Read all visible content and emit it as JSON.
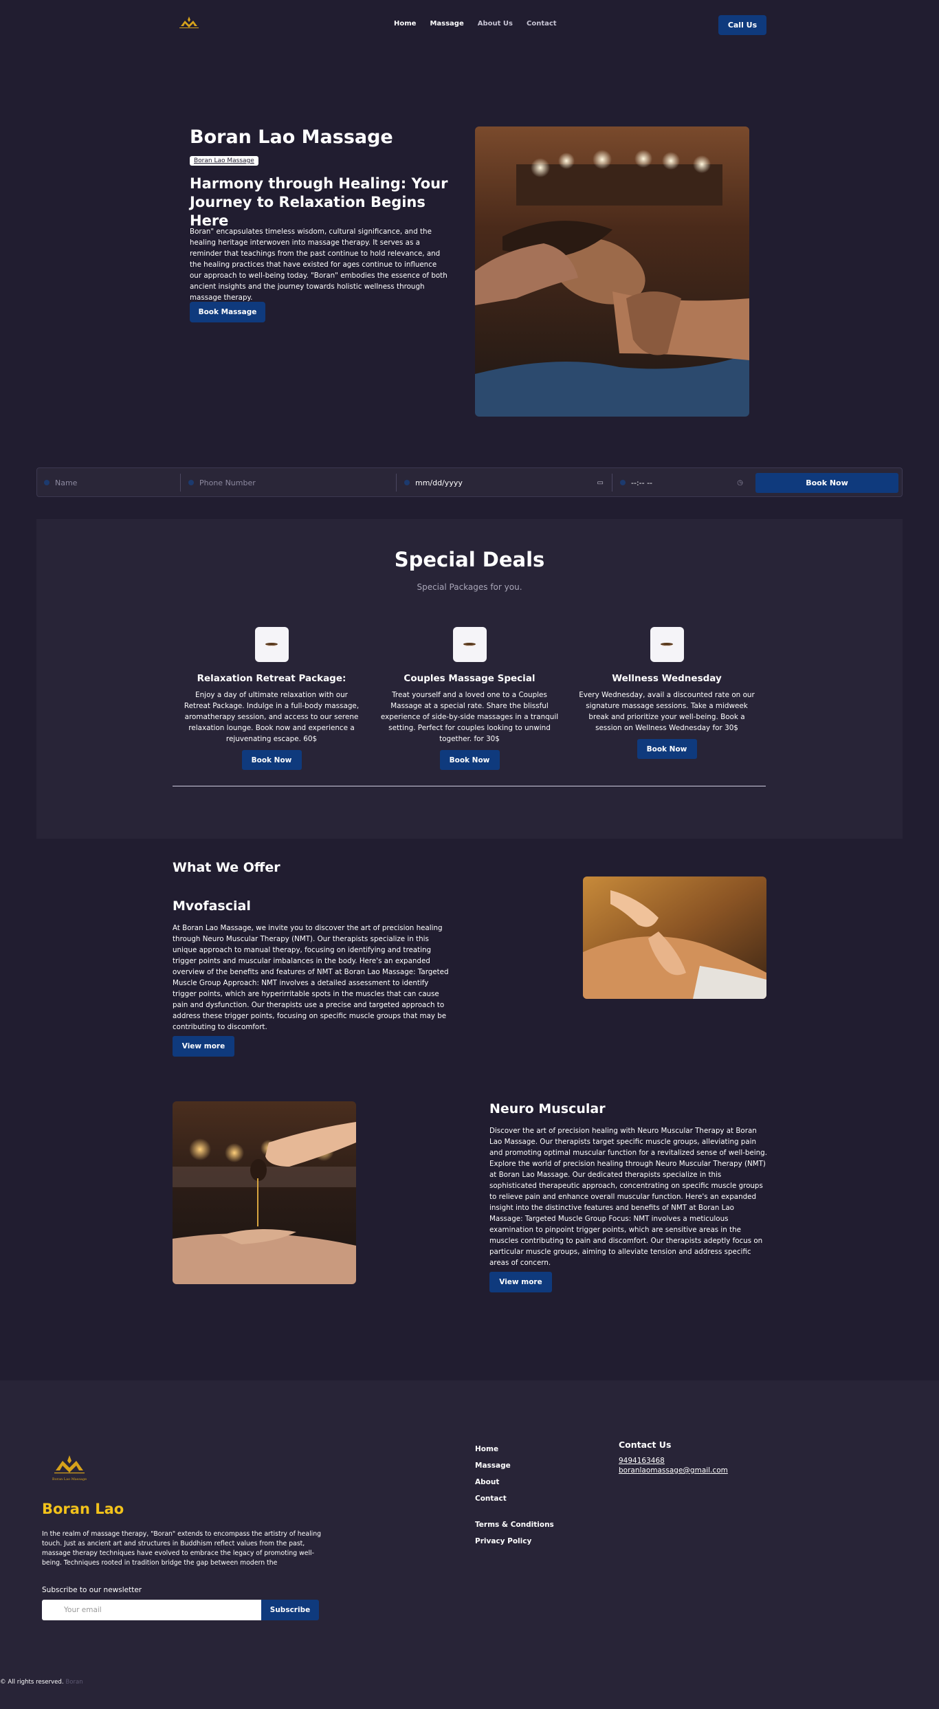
{
  "header": {
    "logo_text": "Boran Lao Massage",
    "nav": [
      "Home",
      "Massage",
      "About Us",
      "Contact"
    ],
    "cta": "Call Us"
  },
  "hero": {
    "title": "Boran Lao Massage",
    "tag": "Boran Lao Massage",
    "subtitle": "Harmony through Healing: Your Journey to Relaxation Begins Here",
    "description": "Boran\" encapsulates timeless wisdom, cultural significance, and the healing heritage interwoven into massage therapy. It serves as a reminder that teachings from the past continue to hold relevance, and the healing practices that have existed for ages continue to influence our approach to well-being today. \"Boran\" embodies the essence of both ancient insights and the journey towards holistic wellness through massage therapy.",
    "button": "Book Massage"
  },
  "booking": {
    "name_placeholder": "Name",
    "phone_placeholder": "Phone Number",
    "date_value": "mm/dd/yyyy",
    "time_value": "--:-- --",
    "button": "Book Now"
  },
  "deals": {
    "title": "Special Deals",
    "subtitle": "Special Packages for you.",
    "items": [
      {
        "title": "Relaxation Retreat Package:",
        "text": "Enjoy a day of ultimate relaxation with our Retreat Package. Indulge in a full-body massage, aromatherapy session, and access to our serene relaxation lounge. Book now and experience a rejuvenating escape. 60$",
        "button": "Book Now"
      },
      {
        "title": "Couples Massage Special",
        "text": "Treat yourself and a loved one to a Couples Massage at a special rate. Share the blissful experience of side-by-side massages in a tranquil setting. Perfect for couples looking to unwind together. for 30$",
        "button": "Book Now"
      },
      {
        "title": "Wellness Wednesday",
        "text": "Every Wednesday, avail a discounted rate on our signature massage sessions. Take a midweek break and prioritize your well-being. Book a session on Wellness Wednesday for 30$",
        "button": "Book Now"
      }
    ]
  },
  "offer": {
    "title": "What We Offer",
    "services": [
      {
        "title": "Mvofascial",
        "text": "At Boran Lao Massage, we invite you to discover the art of precision healing through Neuro Muscular Therapy (NMT). Our therapists specialize in this unique approach to manual therapy, focusing on identifying and treating trigger points and muscular imbalances in the body. Here's an expanded overview of the benefits and features of NMT at Boran Lao Massage: Targeted Muscle Group Approach: NMT involves a detailed assessment to identify trigger points, which are hyperirritable spots in the muscles that can cause pain and dysfunction. Our therapists use a precise and targeted approach to address these trigger points, focusing on specific muscle groups that may be contributing to discomfort.",
        "button": "View more"
      },
      {
        "title": "Neuro Muscular",
        "text": "Discover the art of precision healing with Neuro Muscular Therapy at Boran Lao Massage. Our therapists target specific muscle groups, alleviating pain and promoting optimal muscular function for a revitalized sense of well-being. Explore the world of precision healing through Neuro Muscular Therapy (NMT) at Boran Lao Massage. Our dedicated therapists specialize in this sophisticated therapeutic approach, concentrating on specific muscle groups to relieve pain and enhance overall muscular function. Here's an expanded insight into the distinctive features and benefits of NMT at Boran Lao Massage: Targeted Muscle Group Focus: NMT involves a meticulous examination to pinpoint trigger points, which are sensitive areas in the muscles contributing to pain and discomfort. Our therapists adeptly focus on particular muscle groups, aiming to alleviate tension and address specific areas of concern.",
        "button": "View more"
      }
    ]
  },
  "footer": {
    "logo_text": "Boran Lao Massage",
    "brand": "Boran Lao",
    "description": "In the realm of massage therapy, \"Boran\" extends to encompass the artistry of healing touch. Just as ancient art and structures in Buddhism reflect values from the past, massage therapy techniques have evolved to embrace the legacy of promoting well-being. Techniques rooted in tradition bridge the gap between modern the",
    "newsletter_label": "Subscribe to our newsletter",
    "email_placeholder": "Your email",
    "subscribe": "Subscribe",
    "links": [
      "Home",
      "Massage",
      "About",
      "Contact"
    ],
    "legal": [
      "Terms & Conditions",
      "Privacy Policy"
    ],
    "contact_title": "Contact Us",
    "phone": "9494163468",
    "email": "boranlaomassage@gmail.com",
    "copyright": "© All rights reserved.",
    "copyright_brand": "Boran"
  },
  "colors": {
    "background": "#211d30",
    "panel": "#282437",
    "accent": "#0f3a7d",
    "brand_gold": "#f2c21b"
  }
}
